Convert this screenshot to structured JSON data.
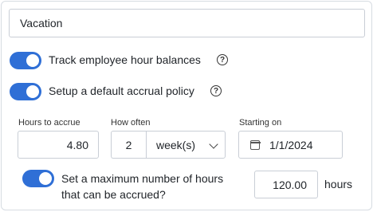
{
  "policy": {
    "name_value": "Vacation"
  },
  "toggles": {
    "track_label": "Track employee hour balances",
    "accrual_label": "Setup a default accrual policy",
    "max_label": "Set a maximum number of hours that can be accrued?"
  },
  "accrual": {
    "hours_label": "Hours to accrue",
    "hours_value": "4.80",
    "how_often_label": "How often",
    "how_often_number": "2",
    "how_often_unit": "week(s)",
    "starting_label": "Starting on",
    "starting_value": "1/1/2024"
  },
  "maximum": {
    "value": "120.00",
    "unit": "hours"
  },
  "colors": {
    "toggle_on": "#2f6fd6"
  }
}
